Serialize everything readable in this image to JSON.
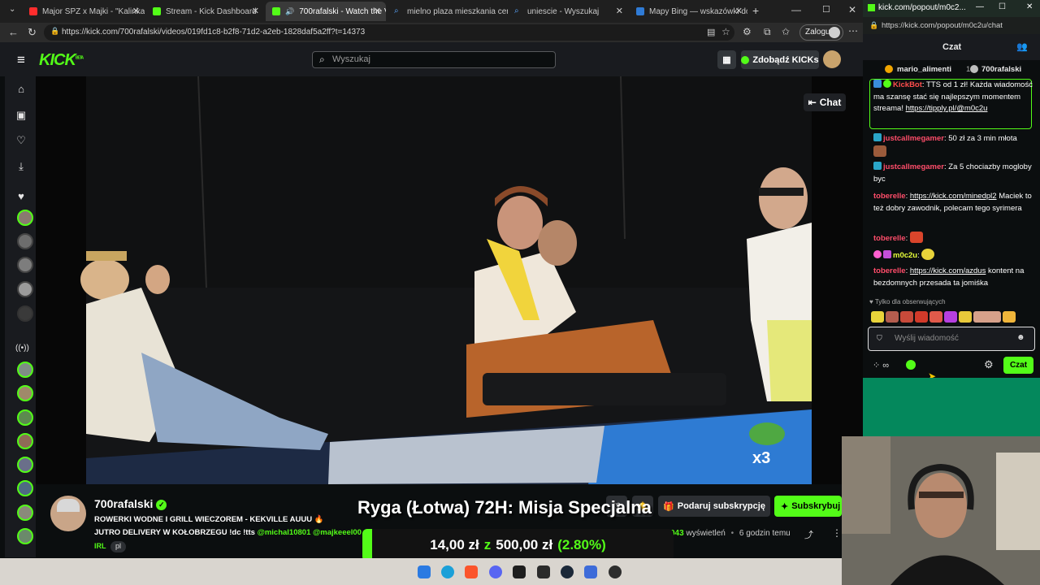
{
  "browser": {
    "tabs": [
      {
        "label": "Major SPZ x Majki - \"Kalinka\"",
        "icon": "youtube-icon",
        "color": "#ff2d2d"
      },
      {
        "label": "Stream - Kick Dashboard",
        "icon": "kick-icon",
        "color": "#53fc18"
      },
      {
        "label": "700rafalski - Watch the VC",
        "icon": "kick-icon",
        "color": "#53fc18"
      },
      {
        "label": "mielno plaza mieszkania cena",
        "icon": "search-icon",
        "color": "#5aa7ff"
      },
      {
        "label": "uniescie - Wyszukaj",
        "icon": "search-icon",
        "color": "#5aa7ff"
      },
      {
        "label": "Mapy Bing — wskazówki dojaz",
        "icon": "map-icon",
        "color": "#5aa7ff"
      }
    ],
    "url": "https://kick.com/700rafalski/videos/019fd1c8-b2f8-71d2-a2eb-1828daf5a2ff?t=14373",
    "profile_label": "Zaloguj"
  },
  "kick": {
    "logo": "KICK",
    "logo_sup": "BETA",
    "search_placeholder": "Wyszukaj",
    "get_kicks": "Zdobądź KICKs",
    "chat_toggle": "Chat"
  },
  "stream": {
    "streamer": "700rafalski",
    "title_line1": "ROWERKI WODNE I GRILL WIECZOREM - KEKVILLE AUUU 🔥",
    "title_line2_prefix": "JUTRO DELIVERY W KOŁOBRZEGU !dc !tts",
    "title_line2_mentions": "@michal10801 @majkeeel00",
    "tags": [
      "IRL",
      "pl"
    ],
    "gift_sub": "Podaruj subskrypcję",
    "subscribe": "Subskrybuj",
    "views_count": "943",
    "views_label": "wyświetleń",
    "time_ago": "6 godzin temu",
    "overlay_title": "Ryga (Łotwa) 72H: Misja Specjalna",
    "goal_current": "14,00 zł",
    "goal_sep": "z",
    "goal_target": "500,00 zł",
    "goal_percent": "(2.80%)",
    "goal_progress": 0.028,
    "video_watermark": "x3"
  },
  "chat": {
    "window_title": "kick.com/popout/m0c2...",
    "url": "https://kick.com/popout/m0c2u/chat",
    "header": "Czat",
    "top_gifters": [
      {
        "name": "mario_alimenti",
        "count": "10"
      },
      {
        "name": "700rafalski",
        "count": ""
      }
    ],
    "messages": [
      {
        "user": "KickBot",
        "color": "#ff4d4d",
        "text": "TTS od 1 zł! Każda wiadomość ma szansę stać się najlepszym momentem streama!",
        "link": "https://tipply.pl/@m0c2u"
      },
      {
        "user": "justcallmegamer",
        "color": "#ff4d6a",
        "text": "50 zł za 3 min młota",
        "link": ""
      },
      {
        "user": "justcallmegamer",
        "color": "#ff4d6a",
        "text": "Za 5 chociazby mogloby byc",
        "link": ""
      },
      {
        "user": "toberelle",
        "color": "#ff4d6a",
        "link": "https://kick.com/minedpl2",
        "text": "Maciek to też dobry zawodnik, polecam tego syrimera"
      },
      {
        "user": "toberelle",
        "color": "#ff4d6a",
        "text": "",
        "link": ""
      },
      {
        "user": "m0c2u",
        "color": "#e8ff3a",
        "text": "",
        "link": ""
      },
      {
        "user": "toberelle",
        "color": "#ff4d6a",
        "link": "https://kick.com/azdus",
        "text": "kontent na bezdomnych przesada ta jomiśka"
      }
    ],
    "followers_only": "Tylko dla obserwujących",
    "input_placeholder": "Wyślij wiadomość",
    "send_label": "Czat"
  },
  "colors": {
    "kick_green": "#53fc18",
    "bg": "#0b0e0f",
    "panel": "#191b1f"
  }
}
